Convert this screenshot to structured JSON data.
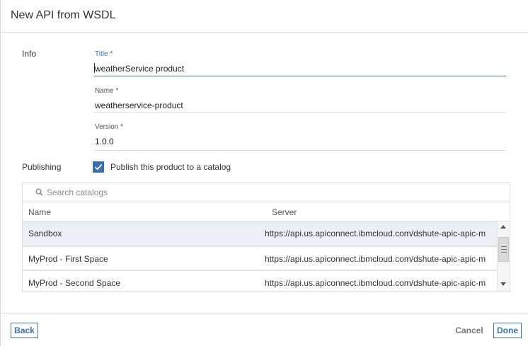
{
  "dialog": {
    "title": "New API from WSDL"
  },
  "info": {
    "section_label": "Info",
    "title_field": {
      "label": "Title",
      "required_mark": "*",
      "value": "weatherService product"
    },
    "name_field": {
      "label": "Name",
      "required_mark": "*",
      "value": "weatherservice-product"
    },
    "version_field": {
      "label": "Version",
      "required_mark": "*",
      "value": "1.0.0"
    }
  },
  "publishing": {
    "section_label": "Publishing",
    "checkbox_label": "Publish this product to a catalog",
    "checked": true
  },
  "catalogs": {
    "search_placeholder": "Search catalogs",
    "columns": [
      "Name",
      "Server"
    ],
    "rows": [
      {
        "name": "Sandbox",
        "server": "https://api.us.apiconnect.ibmcloud.com/dshute-apic-apic-m",
        "selected": true
      },
      {
        "name": "MyProd - First Space",
        "server": "https://api.us.apiconnect.ibmcloud.com/dshute-apic-apic-m",
        "selected": false
      },
      {
        "name": "MyProd - Second Space",
        "server": "https://api.us.apiconnect.ibmcloud.com/dshute-apic-apic-m",
        "selected": false
      }
    ]
  },
  "footer": {
    "back_label": "Back",
    "cancel_label": "Cancel",
    "done_label": "Done"
  },
  "colors": {
    "accent": "#3d70b2",
    "required": "#e0182d",
    "selected_row": "#ebf0f7"
  },
  "icons": [
    "search-icon",
    "checkmark-icon",
    "scroll-up-arrow-icon",
    "scroll-down-arrow-icon"
  ]
}
